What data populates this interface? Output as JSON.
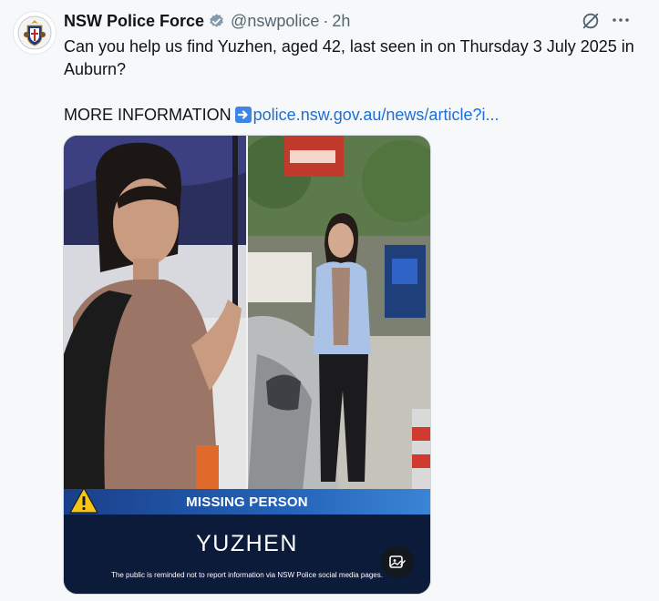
{
  "tweet": {
    "author_name": "NSW Police Force",
    "handle": "@nswpolice",
    "separator": "·",
    "time": "2h",
    "text_line1": "Can you help us find Yuzhen, aged 42, last seen in on Thursday 3 July 2025 in Auburn?",
    "more_info_label": "MORE INFORMATION",
    "link_text": "police.nsw.gov.au/news/article?i..."
  },
  "icons": {
    "avatar": "nsw-police-crest-icon",
    "verified": "verified-badge-icon",
    "grok": "grok-icon",
    "more": "more-icon",
    "arrow": "right-arrow-emoji-icon",
    "warning": "warning-icon",
    "alt": "image-edit-icon"
  },
  "media": {
    "banner_text": "MISSING PERSON",
    "name": "YUZHEN",
    "disclaimer": "The public is reminded not to report information via NSW Police social media pages."
  },
  "colors": {
    "link": "#1d6fd8",
    "banner": "#2463b8",
    "footer": "#0d1b3a",
    "warning": "#f5c518"
  }
}
